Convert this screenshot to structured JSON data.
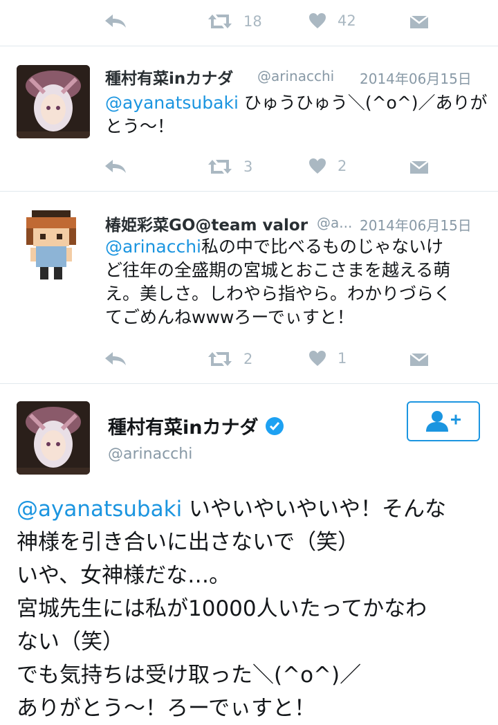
{
  "top_actions": {
    "retweets": "18",
    "likes": "42"
  },
  "tweets": [
    {
      "name": "種村有菜inカナダ",
      "handle": "@arinacchi",
      "date": "2014年06月15日",
      "mention": "@ayanatsubaki",
      "lines": [
        "ひゅうひゅう＼(^o^)／ありが",
        "とう〜！"
      ],
      "retweets": "3",
      "likes": "2"
    },
    {
      "name": "椿姫彩菜GO@team valor",
      "handle": "@a...",
      "date": "2014年06月15日",
      "mention": "@arinacchi",
      "lines": [
        "私の中で比べるものじゃないけ",
        "ど往年の全盛期の宮城とおこさまを越える萌",
        "え。美しさ。しわやら指やら。わかりづらく",
        "てごめんねwwwろーでぃすと！"
      ],
      "retweets": "2",
      "likes": "1"
    }
  ],
  "main_tweet": {
    "name": "種村有菜inカナダ",
    "handle": "@arinacchi",
    "mention": "@ayanatsubaki",
    "lines": [
      "いやいやいやいや！そんな",
      "神様を引き合いに出さないで（笑）",
      "いや、女神様だな…。",
      "宮城先生には私が10000人いたってかなわ",
      "ない（笑）",
      "でも気持ちは受け取った＼(^o^)／",
      "ありがとう〜！ろーでぃすと！"
    ]
  },
  "colors": {
    "link": "#1b95e0",
    "muted": "#aab8c2",
    "border": "#e1e8ed",
    "verified": "#1da1f2"
  }
}
